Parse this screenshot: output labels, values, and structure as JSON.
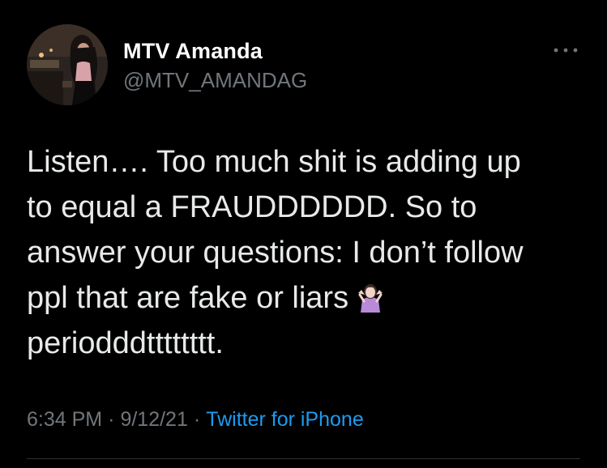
{
  "tweet": {
    "author": {
      "display_name": "MTV Amanda",
      "handle": "@MTV_AMANDAG",
      "avatar_icon": "profile-photo"
    },
    "more_icon": "more-options-icon",
    "text_lines": [
      "Listen…. Too much shit is adding up",
      "to equal a FRAUDDDDDD. So to",
      "answer your questions: I don’t follow",
      "ppl that are fake or liars",
      "perioddd​tttttttt."
    ],
    "emoji": "person-shrugging-emoji",
    "time": "6:34 PM",
    "date": "9/12/21",
    "separator": "·",
    "source": "Twitter for iPhone"
  },
  "colors": {
    "background": "#000000",
    "text": "#e7e9ea",
    "secondary": "#71767b",
    "link": "#1d9bf0"
  }
}
